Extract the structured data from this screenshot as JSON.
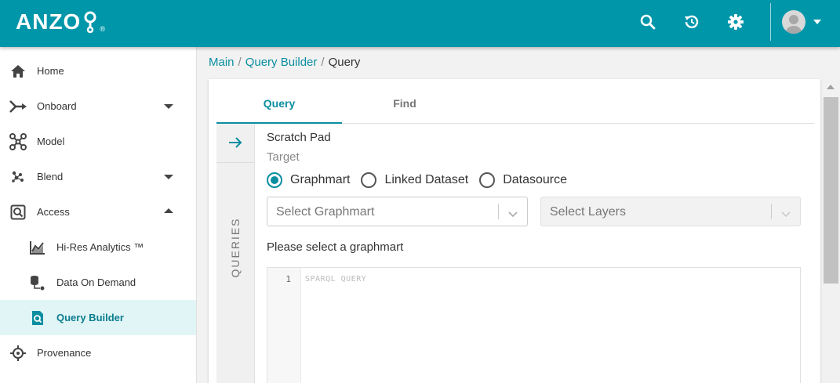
{
  "app": {
    "logo_text": "ANZO",
    "logo_reg": "®"
  },
  "topbar": {
    "icons": [
      "search-icon",
      "history-icon",
      "gear-icon",
      "avatar",
      "chevron-down-icon"
    ]
  },
  "sidebar": {
    "items": [
      {
        "label": "Home",
        "icon": "home-icon"
      },
      {
        "label": "Onboard",
        "icon": "onboard-icon",
        "caret": "down"
      },
      {
        "label": "Model",
        "icon": "model-icon"
      },
      {
        "label": "Blend",
        "icon": "blend-icon",
        "caret": "down"
      },
      {
        "label": "Access",
        "icon": "access-icon",
        "caret": "up"
      },
      {
        "label": "Hi-Res Analytics ™",
        "icon": "analytics-icon"
      },
      {
        "label": "Data On Demand",
        "icon": "data-on-demand-icon"
      },
      {
        "label": "Query Builder",
        "icon": "query-builder-icon",
        "active": true
      },
      {
        "label": "Provenance",
        "icon": "provenance-icon"
      }
    ]
  },
  "breadcrumb": {
    "main": "Main",
    "query_builder": "Query Builder",
    "current": "Query",
    "separator": "/"
  },
  "tabs": {
    "query": "Query",
    "find": "Find"
  },
  "rail": {
    "label": "QUERIES"
  },
  "scratch": {
    "title": "Scratch Pad",
    "target_label": "Target",
    "radios": {
      "graphmart": "Graphmart",
      "linked_dataset": "Linked Dataset",
      "datasource": "Datasource"
    },
    "selected_radio": "Graphmart",
    "select_graphmart_placeholder": "Select Graphmart",
    "select_layers_placeholder": "Select Layers",
    "message": "Please select a graphmart"
  },
  "editor": {
    "line_number": "1",
    "placeholder": "SPARQL QUERY"
  },
  "colors": {
    "brand": "#0096aa",
    "accent": "#0a8ea0",
    "active_bg": "#e1f5f7"
  }
}
